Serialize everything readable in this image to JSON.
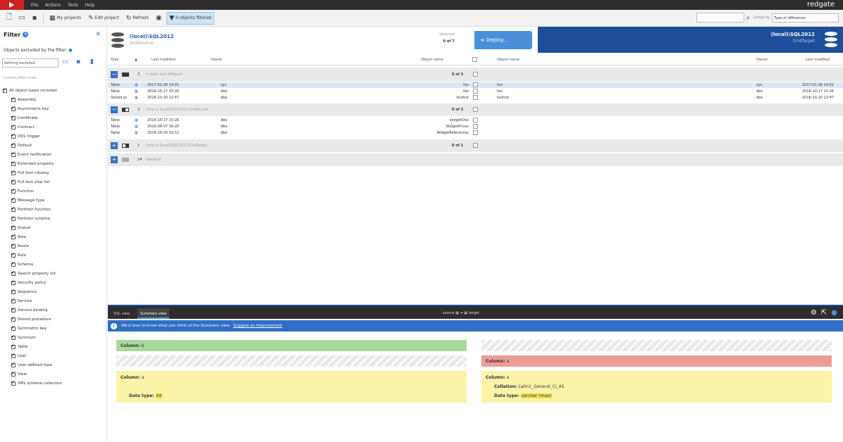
{
  "menu": [
    "File",
    "Actions",
    "Tools",
    "Help"
  ],
  "brand": "redgate",
  "toolbar": {
    "my_projects": "My projects",
    "edit_project": "Edit project",
    "refresh": "Refresh",
    "objects_filtered": "0 objects filtered",
    "group_by": "Group by",
    "group_value": "Type of difference"
  },
  "filter": {
    "title": "Filter",
    "excluded_label": "Objects excluded by the filter:",
    "excluded_select": "Nothing excluded",
    "custom_rules": "Custom filter rules...",
    "all_label": "All object types included",
    "types": [
      "Assembly",
      "Asymmetric key",
      "Certificate",
      "Contract",
      "DDL trigger",
      "Default",
      "Event notification",
      "Extended property",
      "Full text catalog",
      "Full text stop list",
      "Function",
      "Message type",
      "Partition function",
      "Partition scheme",
      "Queue",
      "Role",
      "Route",
      "Rule",
      "Schema",
      "Search property list",
      "Security policy",
      "Sequence",
      "Service",
      "Service binding",
      "Stored procedure",
      "Symmetric key",
      "Synonym",
      "Table",
      "User",
      "User defined type",
      "View",
      "XML schema collection"
    ]
  },
  "source": {
    "name": "(local)\\SQL2012",
    "db": "GridSource"
  },
  "target": {
    "name": "(local)\\SQL2012",
    "db": "GridTarget"
  },
  "selected": {
    "label": "Selected",
    "count": "0 of 7"
  },
  "deploy_label": "Deploy...",
  "columns": {
    "type": "Type",
    "last_modified": "Last modified",
    "owner": "Owner",
    "object_name": "Object name",
    "object_name_r": "Object name",
    "owner_r": "Owner",
    "last_modified_r": "Last modified"
  },
  "groups": [
    {
      "n": "3",
      "desc": "In both, but different",
      "count": "0 of 3"
    },
    {
      "n": "3",
      "desc": "Only in (local)\\SQL2012.GridSource",
      "count": "0 of 3"
    },
    {
      "n": "1",
      "desc": "Only in (local)\\SQL2012.GridTarget",
      "count": "0 of 1"
    },
    {
      "n": "24",
      "desc": "Identical",
      "count": ""
    }
  ],
  "rows_diff": [
    {
      "type": "Table",
      "date": "2017-01-26 14:01",
      "owner": "sys",
      "name": "foo",
      "rname": "foo",
      "rowner": "sys",
      "rdate": "2017-01-26 14:01"
    },
    {
      "type": "Table",
      "date": "2016-10-17 15:26",
      "owner": "dbo",
      "name": "foo",
      "rname": "foo",
      "rowner": "dbo",
      "rdate": "2016-10-17 15:26"
    },
    {
      "type": "Stored pr",
      "date": "2016-10-20 12:47",
      "owner": "dbo",
      "name": "foofnst",
      "rname": "foofnst",
      "rowner": "dbo",
      "rdate": "2016-10-20 12:47"
    }
  ],
  "rows_src": [
    {
      "type": "Table",
      "date": "2016-10-17 15:26",
      "owner": "dbo",
      "name": "widgetOne"
    },
    {
      "type": "Table",
      "date": "2016-09-07 16:20",
      "owner": "dbo",
      "name": "WidgetPrices"
    },
    {
      "type": "Table",
      "date": "2016-10-20 10:12",
      "owner": "dbo",
      "name": "WidgetReferences"
    }
  ],
  "bottom": {
    "tab_sql": "SQL view",
    "tab_summary": "Summary view",
    "src": "source",
    "tgt": "target",
    "banner": "We'd love to know what you think of the Summary view.",
    "banner_link": "Suggest an improvement"
  },
  "summary": {
    "left_col1": "Column:",
    "left_col1_val": "b",
    "left_col2": "Column:",
    "left_col2_val": "a",
    "left_dtype": "Data type:",
    "left_dtype_val": "int",
    "right_col1": "Column:",
    "right_col1_val": "a",
    "right_col2": "Column:",
    "right_col2_val": "a",
    "right_coll": "Collation:",
    "right_coll_val": "Latin1_General_CI_AS",
    "right_dtype": "Data type:",
    "right_dtype_val": "varchar (max)"
  }
}
